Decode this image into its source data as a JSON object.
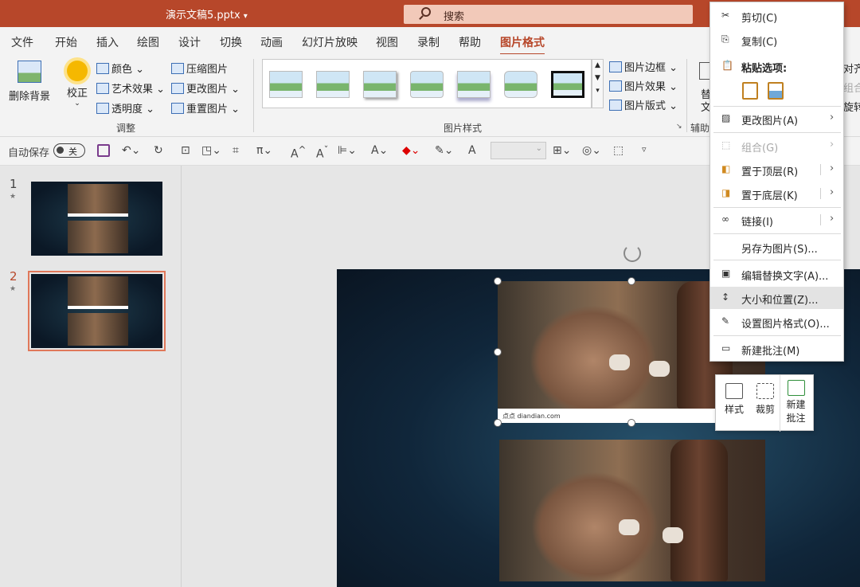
{
  "app": {
    "title": "演示文稿5.pptx",
    "title_caret": "▾",
    "search_placeholder": "搜索",
    "accent": "#b7472a"
  },
  "tabs": [
    "文件",
    "开始",
    "插入",
    "绘图",
    "设计",
    "切换",
    "动画",
    "幻灯片放映",
    "视图",
    "录制",
    "帮助",
    "图片格式"
  ],
  "active_tab": "图片格式",
  "ribbon": {
    "remove_bg": "删除背景",
    "correct": "校正",
    "color": "颜色",
    "art_effects": "艺术效果",
    "transparency": "透明度",
    "compress": "压缩图片",
    "change_picture": "更改图片",
    "reset_picture": "重置图片",
    "group_adjust": "调整",
    "group_styles": "图片样式",
    "border": "图片边框",
    "effects": "图片效果",
    "layout": "图片版式",
    "aux_partial": "辅助",
    "alt_partial1": "替",
    "alt_partial2": "文",
    "align_partial": "对齐",
    "group_partial": "组合",
    "rotate_partial": "旋转"
  },
  "qat": {
    "autosave": "自动保存",
    "toggle_state": "关"
  },
  "slides": [
    {
      "number": "1",
      "star": "★"
    },
    {
      "number": "2",
      "star": "★"
    }
  ],
  "watermark": "点点 diandian.com",
  "context_menu": {
    "cut": "剪切(C)",
    "copy": "复制(C)",
    "paste_options": "粘贴选项:",
    "change_picture": "更改图片(A)",
    "group": "组合(G)",
    "bring_front": "置于顶层(R)",
    "send_back": "置于底层(K)",
    "link": "链接(I)",
    "save_as_picture": "另存为图片(S)...",
    "edit_alt_text": "编辑替换文字(A)...",
    "size_position": "大小和位置(Z)...",
    "format_picture": "设置图片格式(O)...",
    "new_comment": "新建批注(M)"
  },
  "mini_toolbar": {
    "style": "样式",
    "crop": "裁剪",
    "new_comment_l1": "新建",
    "new_comment_l2": "批注"
  }
}
